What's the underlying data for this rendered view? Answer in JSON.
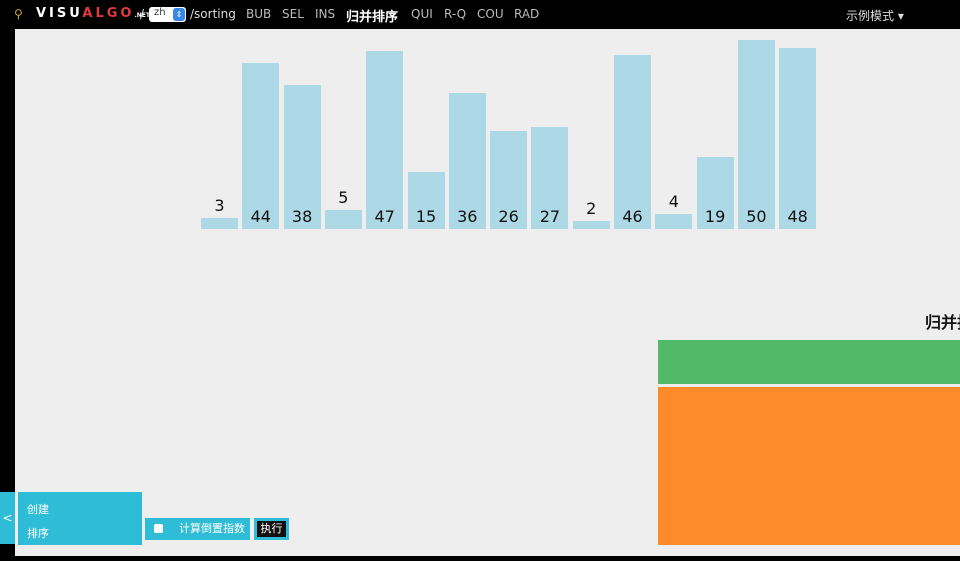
{
  "header": {
    "logo_a": "VISU",
    "logo_b": "ALGO",
    "logo_c": ".NET",
    "sep": "/",
    "lang": "zh",
    "path": "/sorting",
    "nav": [
      "BUB",
      "SEL",
      "INS",
      "归并排序",
      "QUI",
      "R-Q",
      "COU",
      "RAD"
    ],
    "active": 3,
    "mode": "示例模式 ▾"
  },
  "array": [
    3,
    44,
    38,
    5,
    47,
    15,
    36,
    26,
    27,
    2,
    46,
    4,
    19,
    50,
    48
  ],
  "colors": {
    "bar": "#add8e6",
    "green": "#52b968",
    "orange": "#fd8a2b",
    "panel": "#2fbcd6"
  },
  "codetrace": {
    "title": "归并排序"
  },
  "actions": {
    "handle": "<",
    "create": "创建",
    "sort": "排序",
    "inversion_label": "计算倒置指数",
    "run": "执行"
  }
}
